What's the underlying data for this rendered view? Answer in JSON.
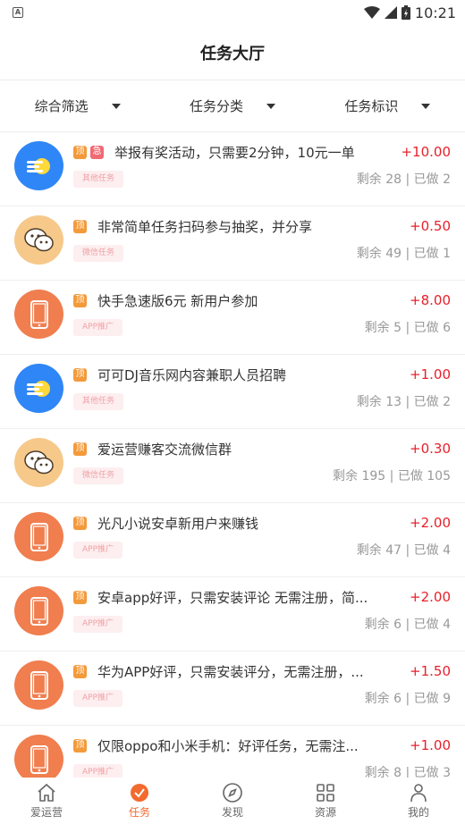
{
  "status_bar": {
    "time": "10:21"
  },
  "header": {
    "title": "任务大厅"
  },
  "filters": [
    {
      "label": "综合筛选"
    },
    {
      "label": "任务分类"
    },
    {
      "label": "任务标识"
    }
  ],
  "badges": {
    "top": "顶",
    "urgent": "急"
  },
  "tasks": [
    {
      "title": "举报有奖活动，只需要2分钟，10元一单",
      "reward": "+10.00",
      "tag": "其他任务",
      "stats": "剩余 28 | 已做 2",
      "icon": "lines-icon",
      "color": "#2f86f6",
      "urgent": true
    },
    {
      "title": "非常简单任务扫码参与抽奖，并分享",
      "reward": "+0.50",
      "tag": "微信任务",
      "stats": "剩余 49 | 已做 1",
      "icon": "wechat-icon",
      "color": "#f6c98a",
      "urgent": false
    },
    {
      "title": "快手急速版6元 新用户参加",
      "reward": "+8.00",
      "tag": "APP推广",
      "stats": "剩余 5 | 已做 6",
      "icon": "phone-icon",
      "color": "#f07e4f",
      "urgent": false
    },
    {
      "title": "可可DJ音乐网内容兼职人员招聘",
      "reward": "+1.00",
      "tag": "其他任务",
      "stats": "剩余 13 | 已做 2",
      "icon": "lines-icon",
      "color": "#2f86f6",
      "urgent": false
    },
    {
      "title": "爱运营赚客交流微信群",
      "reward": "+0.30",
      "tag": "微信任务",
      "stats": "剩余 195 | 已做 105",
      "icon": "wechat-icon",
      "color": "#f6c98a",
      "urgent": false
    },
    {
      "title": "光凡小说安卓新用户来赚钱",
      "reward": "+2.00",
      "tag": "APP推广",
      "stats": "剩余 47 | 已做 4",
      "icon": "phone-icon",
      "color": "#f07e4f",
      "urgent": false
    },
    {
      "title": "安卓app好评，只需安装评论 无需注册，简...",
      "reward": "+2.00",
      "tag": "APP推广",
      "stats": "剩余 6 | 已做 4",
      "icon": "phone-icon",
      "color": "#f07e4f",
      "urgent": false
    },
    {
      "title": "华为APP好评，只需安装评分，无需注册，...",
      "reward": "+1.50",
      "tag": "APP推广",
      "stats": "剩余 6 | 已做 9",
      "icon": "phone-icon",
      "color": "#f07e4f",
      "urgent": false
    },
    {
      "title": "仅限oppo和小米手机：好评任务，无需注...",
      "reward": "+1.00",
      "tag": "APP推广",
      "stats": "剩余 8 | 已做 3",
      "icon": "phone-icon",
      "color": "#f07e4f",
      "urgent": false
    }
  ],
  "tabbar": {
    "items": [
      {
        "label": "爱运营",
        "icon": "home-icon",
        "active": false
      },
      {
        "label": "任务",
        "icon": "check-circle-icon",
        "active": true
      },
      {
        "label": "发现",
        "icon": "compass-icon",
        "active": false
      },
      {
        "label": "资源",
        "icon": "grid-icon",
        "active": false
      },
      {
        "label": "我的",
        "icon": "person-icon",
        "active": false
      }
    ]
  },
  "colors": {
    "accent": "#f26a2e",
    "reward": "#e8202a"
  }
}
